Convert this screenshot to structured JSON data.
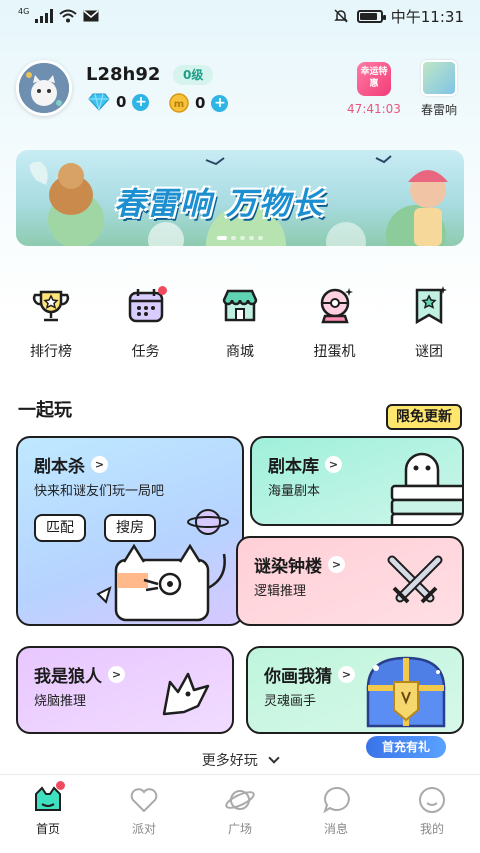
{
  "status_bar": {
    "network": "4G",
    "time": "中午11:31"
  },
  "profile": {
    "username": "L28h92",
    "level": "0级",
    "diamonds": "0",
    "coins": "0"
  },
  "lucky": {
    "label": "幸运特惠",
    "timer": "47:41:03"
  },
  "event": {
    "label": "春雷响"
  },
  "banner": {
    "title": "春雷响 万物长"
  },
  "quick_nav": [
    {
      "label": "排行榜",
      "icon": "trophy-icon"
    },
    {
      "label": "任务",
      "icon": "calendar-icon"
    },
    {
      "label": "商城",
      "icon": "shop-icon"
    },
    {
      "label": "扭蛋机",
      "icon": "gacha-icon"
    },
    {
      "label": "谜团",
      "icon": "banner-flag-icon"
    }
  ],
  "section": {
    "title": "一起玩"
  },
  "badge": {
    "limited": "限免更新"
  },
  "cards": {
    "script_kill": {
      "title": "剧本杀",
      "subtitle": "快来和谜友们玩一局吧",
      "match": "匹配",
      "search": "搜房"
    },
    "library": {
      "title": "剧本库",
      "subtitle": "海量剧本"
    },
    "tower": {
      "title": "谜染钟楼",
      "subtitle": "逻辑推理"
    },
    "werewolf": {
      "title": "我是狼人",
      "subtitle": "烧脑推理"
    },
    "draw": {
      "title": "你画我猜",
      "subtitle": "灵魂画手"
    }
  },
  "first_charge": {
    "label": "首充有礼"
  },
  "more_games": "更多好玩",
  "bottom_nav": [
    {
      "label": "首页",
      "icon": "home-cat-icon"
    },
    {
      "label": "派对",
      "icon": "heart-icon"
    },
    {
      "label": "广场",
      "icon": "planet-icon"
    },
    {
      "label": "消息",
      "icon": "message-icon"
    },
    {
      "label": "我的",
      "icon": "smile-icon"
    }
  ],
  "colors": {
    "accent": "#2fb4e6",
    "brand_green": "#1e9d87",
    "notification": "#f04a5f",
    "lucky_red": "#e8557d"
  }
}
